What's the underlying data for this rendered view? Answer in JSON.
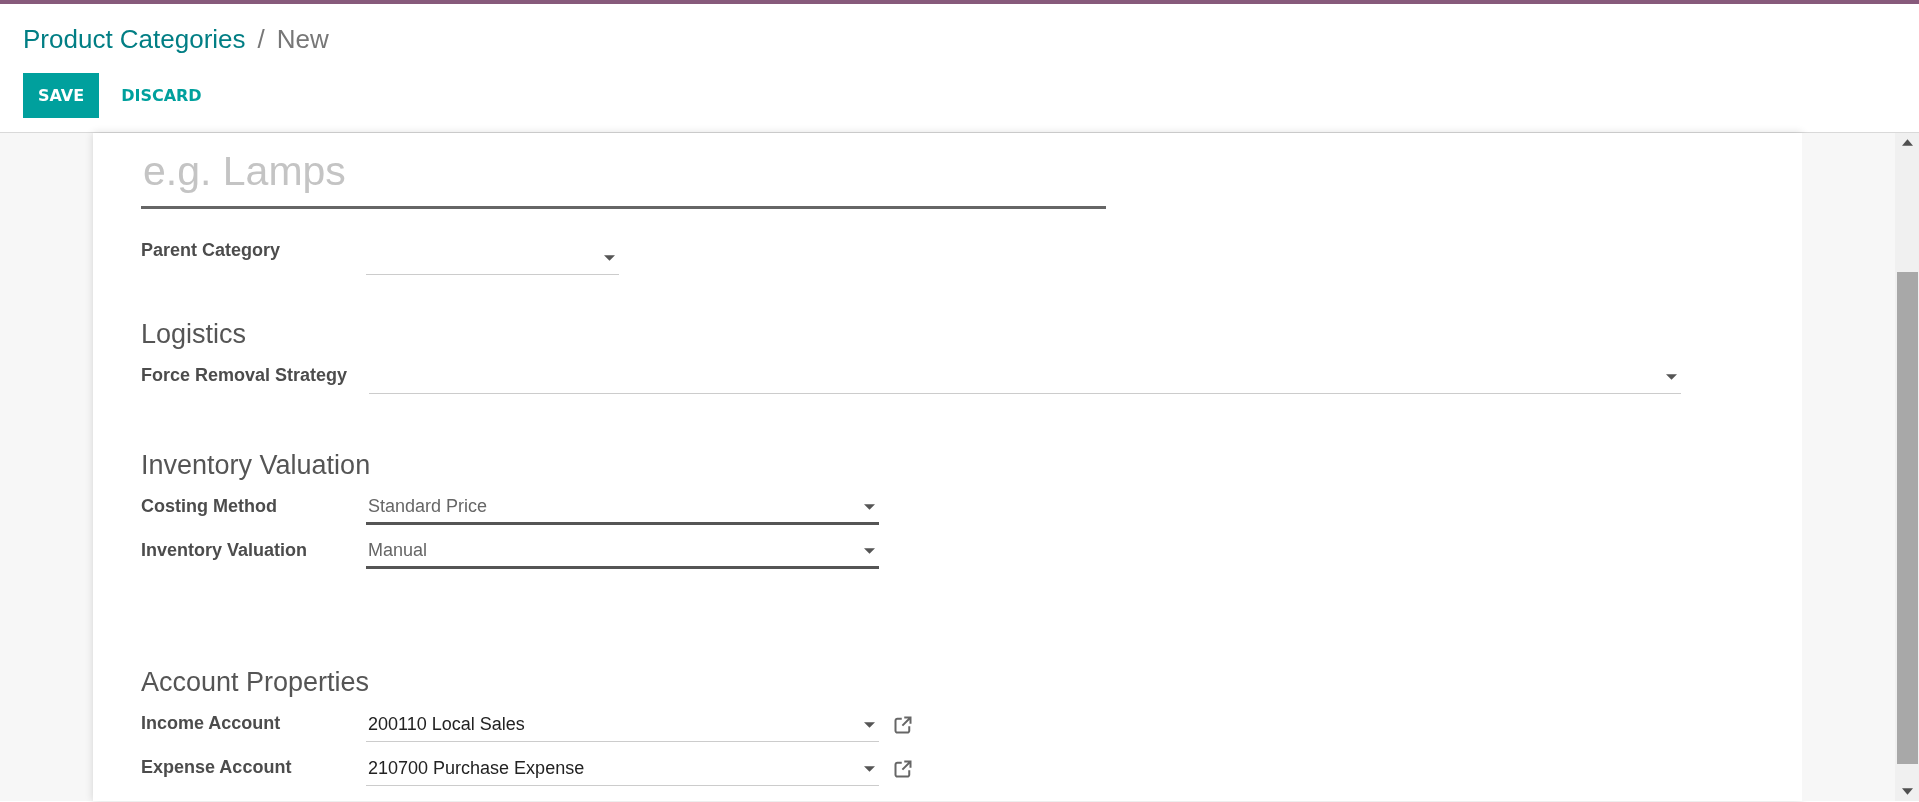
{
  "breadcrumb": {
    "parent": "Product Categories",
    "separator": "/",
    "current": "New"
  },
  "buttons": [
    {
      "label": "SAVE",
      "kind": "primary"
    },
    {
      "label": "DISCARD",
      "kind": "link"
    }
  ],
  "name_field": {
    "placeholder": "e.g. Lamps"
  },
  "sections": [
    {
      "fields": [
        {
          "label": "Parent Category",
          "required": false,
          "external_link": false
        }
      ]
    },
    {
      "title": "Logistics",
      "fields": [
        {
          "label": "Force Removal Strategy",
          "required": false,
          "external_link": false
        }
      ]
    },
    {
      "title": "Inventory Valuation",
      "fields": [
        {
          "label": "Costing Method",
          "value": "Standard Price",
          "required": true,
          "external_link": false
        },
        {
          "label": "Inventory Valuation",
          "value": "Manual",
          "required": true,
          "external_link": false
        }
      ]
    },
    {
      "title": "Account Properties",
      "fields": [
        {
          "label": "Income Account",
          "value": "200110 Local Sales",
          "required": false,
          "external_link": true
        },
        {
          "label": "Expense Account",
          "value": "210700 Purchase Expense",
          "required": false,
          "external_link": true
        }
      ]
    }
  ]
}
